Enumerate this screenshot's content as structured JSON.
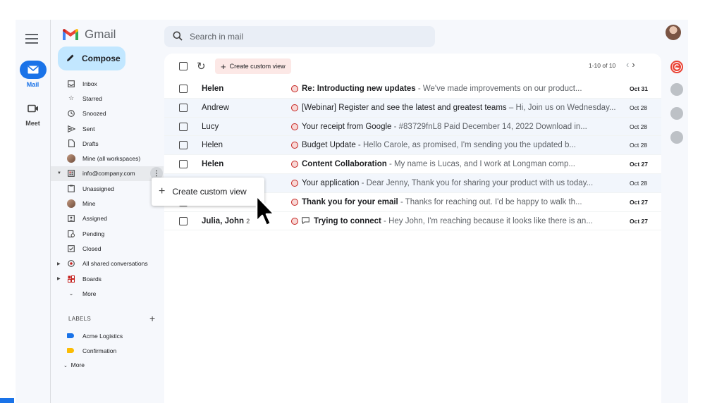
{
  "app": {
    "name": "Gmail"
  },
  "search": {
    "placeholder": "Search in mail"
  },
  "rail": {
    "mail_label": "Mail",
    "meet_label": "Meet"
  },
  "compose_label": "Compose",
  "nav": [
    {
      "label": "Inbox",
      "icon": "inbox-icon"
    },
    {
      "label": "Starred",
      "icon": "star-icon"
    },
    {
      "label": "Snoozed",
      "icon": "clock-icon"
    },
    {
      "label": "Sent",
      "icon": "send-icon"
    },
    {
      "label": "Drafts",
      "icon": "draft-icon"
    },
    {
      "label": "Mine (all workspaces)",
      "icon": "avatar-icon"
    },
    {
      "label": "info@company.com",
      "icon": "shared-inbox-icon"
    },
    {
      "label": "Unassigned",
      "icon": "clipboard-icon"
    },
    {
      "label": "Mine",
      "icon": "avatar-icon"
    },
    {
      "label": "Assigned",
      "icon": "assigned-icon"
    },
    {
      "label": "Pending",
      "icon": "pending-icon"
    },
    {
      "label": "Closed",
      "icon": "check-box-icon"
    },
    {
      "label": "All shared conversations",
      "icon": "shared-icon"
    },
    {
      "label": "Boards",
      "icon": "boards-icon"
    },
    {
      "label": "More",
      "icon": "chevron-down-icon"
    }
  ],
  "labels": {
    "heading": "LABELS",
    "items": [
      {
        "label": "Acme Logistics",
        "color": "#1a73e8"
      },
      {
        "label": "Confirmation",
        "color": "#fbbc04"
      }
    ],
    "more": "More"
  },
  "toolbar": {
    "create_custom_view": "Create custom view",
    "pager": "1-10 of 10"
  },
  "popup": {
    "label": "Create custom view"
  },
  "emails": [
    {
      "sender": "Helen",
      "count": "",
      "subject": "Re: Introducting new updates",
      "snippet": " - We've made improvements on our product...",
      "date": "Oct 31",
      "unread": true,
      "chat": false
    },
    {
      "sender": "Andrew",
      "count": "",
      "subject": "[Webinar] Register and see the latest and greatest teams",
      "snippet": " – Hi, Join us on Wednesday...",
      "date": "Oct 28",
      "unread": false,
      "chat": false
    },
    {
      "sender": "Lucy",
      "count": "",
      "subject": "Your receipt from Google",
      "snippet": " - #83729fnL8 Paid December 14, 2022 Download in...",
      "date": "Oct 28",
      "unread": false,
      "chat": false
    },
    {
      "sender": "Helen",
      "count": "",
      "subject": "Budget Update",
      "snippet": " - Hello Carole, as promised, I'm sending you the updated b...",
      "date": "Oct 28",
      "unread": false,
      "chat": false
    },
    {
      "sender": "Helen",
      "count": "",
      "subject": "Content Collaboration",
      "snippet": " - My name is  Lucas, and I work at Longman comp...",
      "date": "Oct 27",
      "unread": true,
      "chat": false
    },
    {
      "sender": "",
      "count": "",
      "subject": "Your application",
      "snippet": " - Dear Jenny, Thank you for sharing your product with us today...",
      "date": "Oct 28",
      "unread": false,
      "chat": false
    },
    {
      "sender": "",
      "count": "",
      "subject": "Thank you for your email",
      "snippet": " - Thanks for reaching out. I'd be happy to walk th...",
      "date": "Oct 27",
      "unread": true,
      "chat": false
    },
    {
      "sender": "Julia, John",
      "count": "2",
      "subject": "Trying to connect",
      "snippet": " - Hey John, I'm reaching because it looks like there is an...",
      "date": "Oct 27",
      "unread": true,
      "chat": true
    }
  ]
}
